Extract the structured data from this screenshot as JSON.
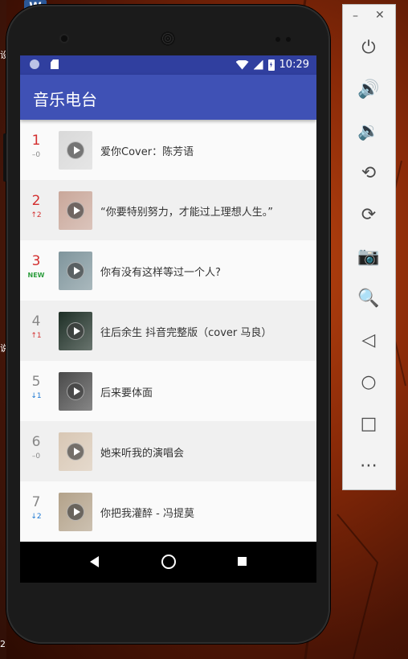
{
  "desktop": {
    "word_icon_letter": "W",
    "edge_chars": [
      "设",
      "说",
      "2"
    ]
  },
  "status_bar": {
    "time": "10:29",
    "icons": [
      "notification-dot-icon",
      "sd-card-icon",
      "wifi-icon",
      "signal-icon",
      "battery-icon"
    ]
  },
  "app": {
    "title": "音乐电台"
  },
  "songs": [
    {
      "rank": "1",
      "change": "–0",
      "change_color": "#888888",
      "rank_color": "#d32f2f",
      "title": "爱你Cover：陈芳语",
      "thumb": "#d9d9d9"
    },
    {
      "rank": "2",
      "change": "↑2",
      "change_color": "#d32f2f",
      "rank_color": "#d32f2f",
      "title": "“你要特别努力，才能过上理想人生。”",
      "thumb": "#c9a79a"
    },
    {
      "rank": "3",
      "change": "NEW",
      "change_color": "#2e9e3f",
      "rank_color": "#d32f2f",
      "title": "你有没有这样等过一个人?",
      "thumb": "#7f959c"
    },
    {
      "rank": "4",
      "change": "↑1",
      "change_color": "#d32f2f",
      "rank_color": "#888888",
      "title": "往后余生 抖音完整版（cover 马良）",
      "thumb": "#1e2f26"
    },
    {
      "rank": "5",
      "change": "↓1",
      "change_color": "#1976d2",
      "rank_color": "#888888",
      "title": "后来要体面",
      "thumb": "#4a4a4a"
    },
    {
      "rank": "6",
      "change": "–0",
      "change_color": "#888888",
      "rank_color": "#888888",
      "title": "她来听我的演唱会",
      "thumb": "#d8c7b4"
    },
    {
      "rank": "7",
      "change": "↓2",
      "change_color": "#1976d2",
      "rank_color": "#888888",
      "title": "你把我灌醉 - 冯提莫",
      "thumb": "#b3a28a"
    }
  ],
  "emulator": {
    "minimize": "–",
    "close": "✕",
    "buttons": [
      {
        "name": "power-icon",
        "glyph": "⏻"
      },
      {
        "name": "volume-up-icon",
        "glyph": "🔊"
      },
      {
        "name": "volume-down-icon",
        "glyph": "🔉"
      },
      {
        "name": "rotate-left-icon",
        "glyph": "⟲"
      },
      {
        "name": "rotate-right-icon",
        "glyph": "⟳"
      },
      {
        "name": "camera-icon",
        "glyph": "📷"
      },
      {
        "name": "zoom-icon",
        "glyph": "🔍"
      },
      {
        "name": "back-icon",
        "glyph": "◁"
      },
      {
        "name": "home-icon",
        "glyph": "○"
      },
      {
        "name": "overview-icon",
        "glyph": "□"
      },
      {
        "name": "more-icon",
        "glyph": "⋯"
      }
    ]
  }
}
